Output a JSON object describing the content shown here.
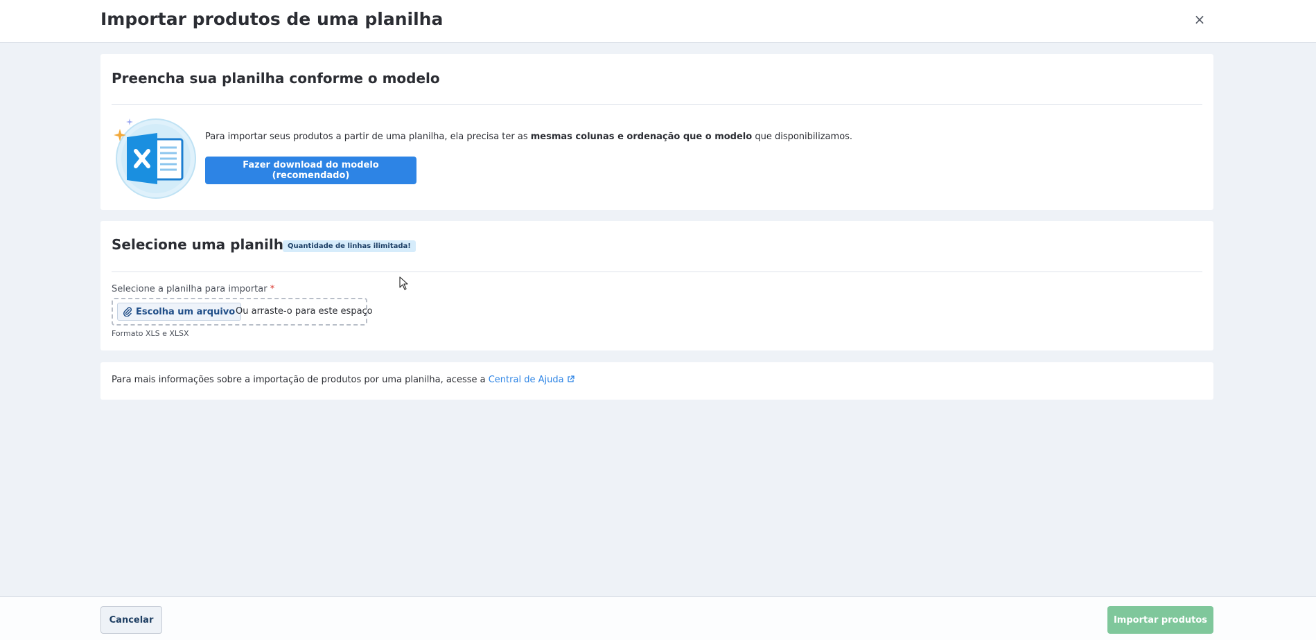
{
  "header": {
    "title": "Importar produtos de uma planilha",
    "close_label": "×"
  },
  "template_section": {
    "title": "Preencha sua planilha conforme o modelo",
    "info_prefix": "Para importar seus produtos a partir de uma planilha, ela precisa ter as ",
    "info_bold": "mesmas colunas e ordenação que o modelo",
    "info_suffix": " que disponibilizamos.",
    "download_button": "Fazer download do modelo (recomendado)",
    "illustration_icon": "excel-spreadsheet-icon"
  },
  "upload_section": {
    "title": "Selecione uma planilha",
    "badge": "Quantidade de linhas ilimitada!",
    "field_label": "Selecione a planilha para importar",
    "required_marker": "*",
    "choose_file_button": "Escolha um arquivo",
    "drop_text": "Ou arraste-o para este espaço",
    "format_hint": "Formato XLS e XLSX"
  },
  "help_section": {
    "text": "Para mais informações sobre a importação de produtos por uma planilha, acesse a ",
    "link_text": "Central de Ajuda"
  },
  "footer": {
    "cancel_button": "Cancelar",
    "import_button": "Importar produtos"
  },
  "colors": {
    "primary": "#2d84e5",
    "import_disabled": "#7fc79b",
    "background": "#eef2f7",
    "badge_bg": "#d6ecfb"
  }
}
